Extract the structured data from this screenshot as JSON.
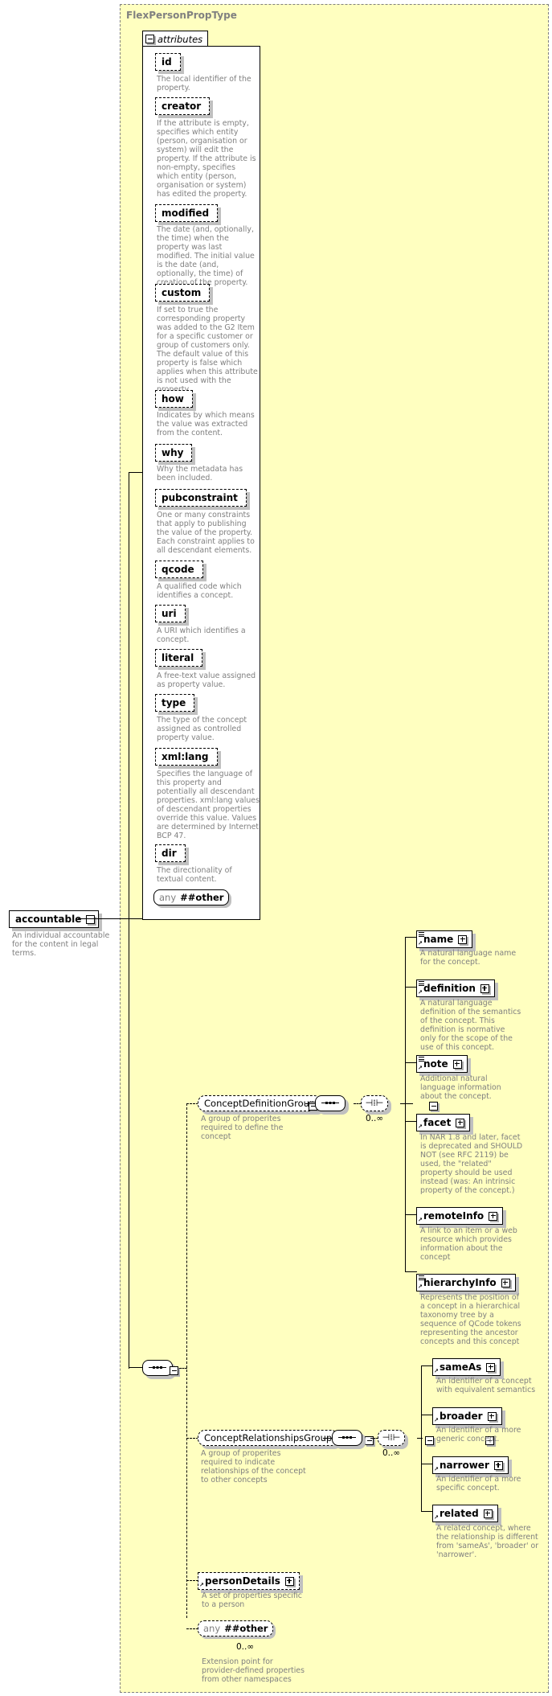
{
  "root": {
    "name": "accountable",
    "description": "An individual accountable for the content in legal terms.",
    "type_name": "FlexPersonPropType"
  },
  "attributes": {
    "tab_label": "attributes",
    "items": [
      {
        "name": "id",
        "description": "The local identifier of the property."
      },
      {
        "name": "creator",
        "description": "If the attribute is empty, specifies which entity (person, organisation or system) will edit the property. If the attribute is non-empty, specifies which entity (person, organisation or system) has edited the property."
      },
      {
        "name": "modified",
        "description": "The date (and, optionally, the time) when the property was last modified. The initial value is the date (and, optionally, the time) of creation of the property."
      },
      {
        "name": "custom",
        "description": "If set to true the corresponding property was added to the G2 Item for a specific customer or group of customers only. The default value of this property is false which applies when this attribute is not used with the property."
      },
      {
        "name": "how",
        "description": "Indicates by which means the value was extracted from the content."
      },
      {
        "name": "why",
        "description": "Why the metadata has been included."
      },
      {
        "name": "pubconstraint",
        "description": "One or many constraints that apply to publishing the value of the property. Each constraint applies to all descendant elements."
      },
      {
        "name": "qcode",
        "description": "A qualified code which identifies a concept."
      },
      {
        "name": "uri",
        "description": "A URI which identifies a concept."
      },
      {
        "name": "literal",
        "description": "A free-text value assigned as property value."
      },
      {
        "name": "type",
        "description": "The type of the concept assigned as controlled property value."
      },
      {
        "name": "xml:lang",
        "description": "Specifies the language of this property and potentially all descendant properties. xml:lang values of descendant properties override this value. Values are determined by Internet BCP 47."
      },
      {
        "name": "dir",
        "description": "The directionality of textual content."
      }
    ],
    "any_other": {
      "any": "any",
      "ns": "##other"
    }
  },
  "groups": {
    "definition": {
      "name": "ConceptDefinitionGroup",
      "description": "A group of properites required to define the concept",
      "multiplicity": "0..∞",
      "elements": [
        {
          "name": "name",
          "description": "A natural language name for the concept."
        },
        {
          "name": "definition",
          "description": "A natural language definition of the semantics of the concept. This definition is normative only for the scope of the use of this concept."
        },
        {
          "name": "note",
          "description": "Additional natural language information about the concept."
        },
        {
          "name": "facet",
          "description": "In NAR 1.8 and later, facet is deprecated and SHOULD NOT (see RFC 2119) be used, the \"related\" property should be used instead (was: An intrinsic property of the concept.)"
        },
        {
          "name": "remoteInfo",
          "description": "A link to an item or a web resource which provides information about the concept"
        },
        {
          "name": "hierarchyInfo",
          "description": "Represents the position of a concept in a hierarchical taxonomy tree by a sequence of QCode tokens representing the ancestor concepts and this concept"
        }
      ]
    },
    "relationships": {
      "name": "ConceptRelationshipsGroup",
      "description": "A group of properites required to indicate relationships of the concept to other concepts",
      "multiplicity": "0..∞",
      "elements": [
        {
          "name": "sameAs",
          "description": "An identifier of a concept with equivalent semantics"
        },
        {
          "name": "broader",
          "description": "An identifier of a more generic concept."
        },
        {
          "name": "narrower",
          "description": "An identifier of a more specific concept."
        },
        {
          "name": "related",
          "description": "A related concept, where the relationship is different from 'sameAs', 'broader' or 'narrower'."
        }
      ]
    }
  },
  "person_details": {
    "name": "personDetails",
    "description": "A set of properties specific to a person"
  },
  "any_other_element": {
    "any": "any",
    "ns": "##other",
    "multiplicity": "0..∞",
    "description": "Extension point for provider-defined properties from other namespaces"
  }
}
